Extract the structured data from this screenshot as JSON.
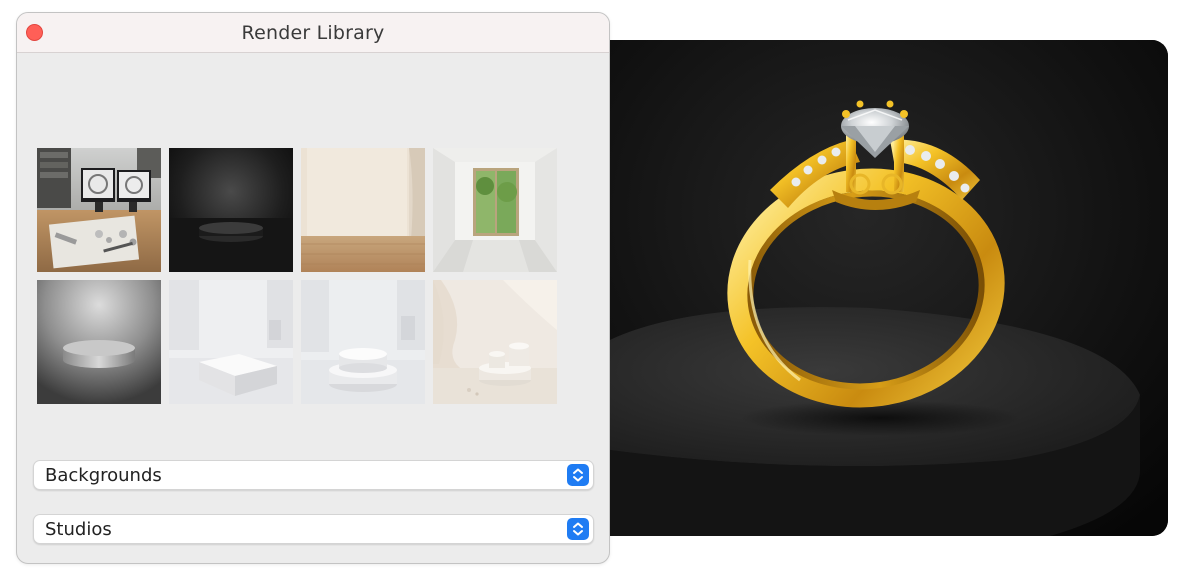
{
  "window": {
    "title": "Render Library"
  },
  "library": {
    "thumbnails": [
      {
        "label": "Jewelry design workspace with CAD monitors"
      },
      {
        "label": "Dark round podium in spotlight"
      },
      {
        "label": "Empty cream room with curtain and wood floor"
      },
      {
        "label": "White room with garden window"
      },
      {
        "label": "Brushed metal disc pedestal"
      },
      {
        "label": "White cube pedestal in bright room"
      },
      {
        "label": "Stacked white round podium"
      },
      {
        "label": "Cream drapery with small podiums"
      }
    ]
  },
  "selectors": {
    "backgrounds": {
      "value": "Backgrounds"
    },
    "studios": {
      "value": "Studios"
    }
  },
  "preview": {
    "subject": "Gold diamond engagement ring on dark pedestal"
  },
  "colors": {
    "close_button": "#ff5f57",
    "stepper_accent": "#1f7cf3",
    "panel_bg": "#ececec",
    "titlebar_bg": "#f7f2f2"
  }
}
